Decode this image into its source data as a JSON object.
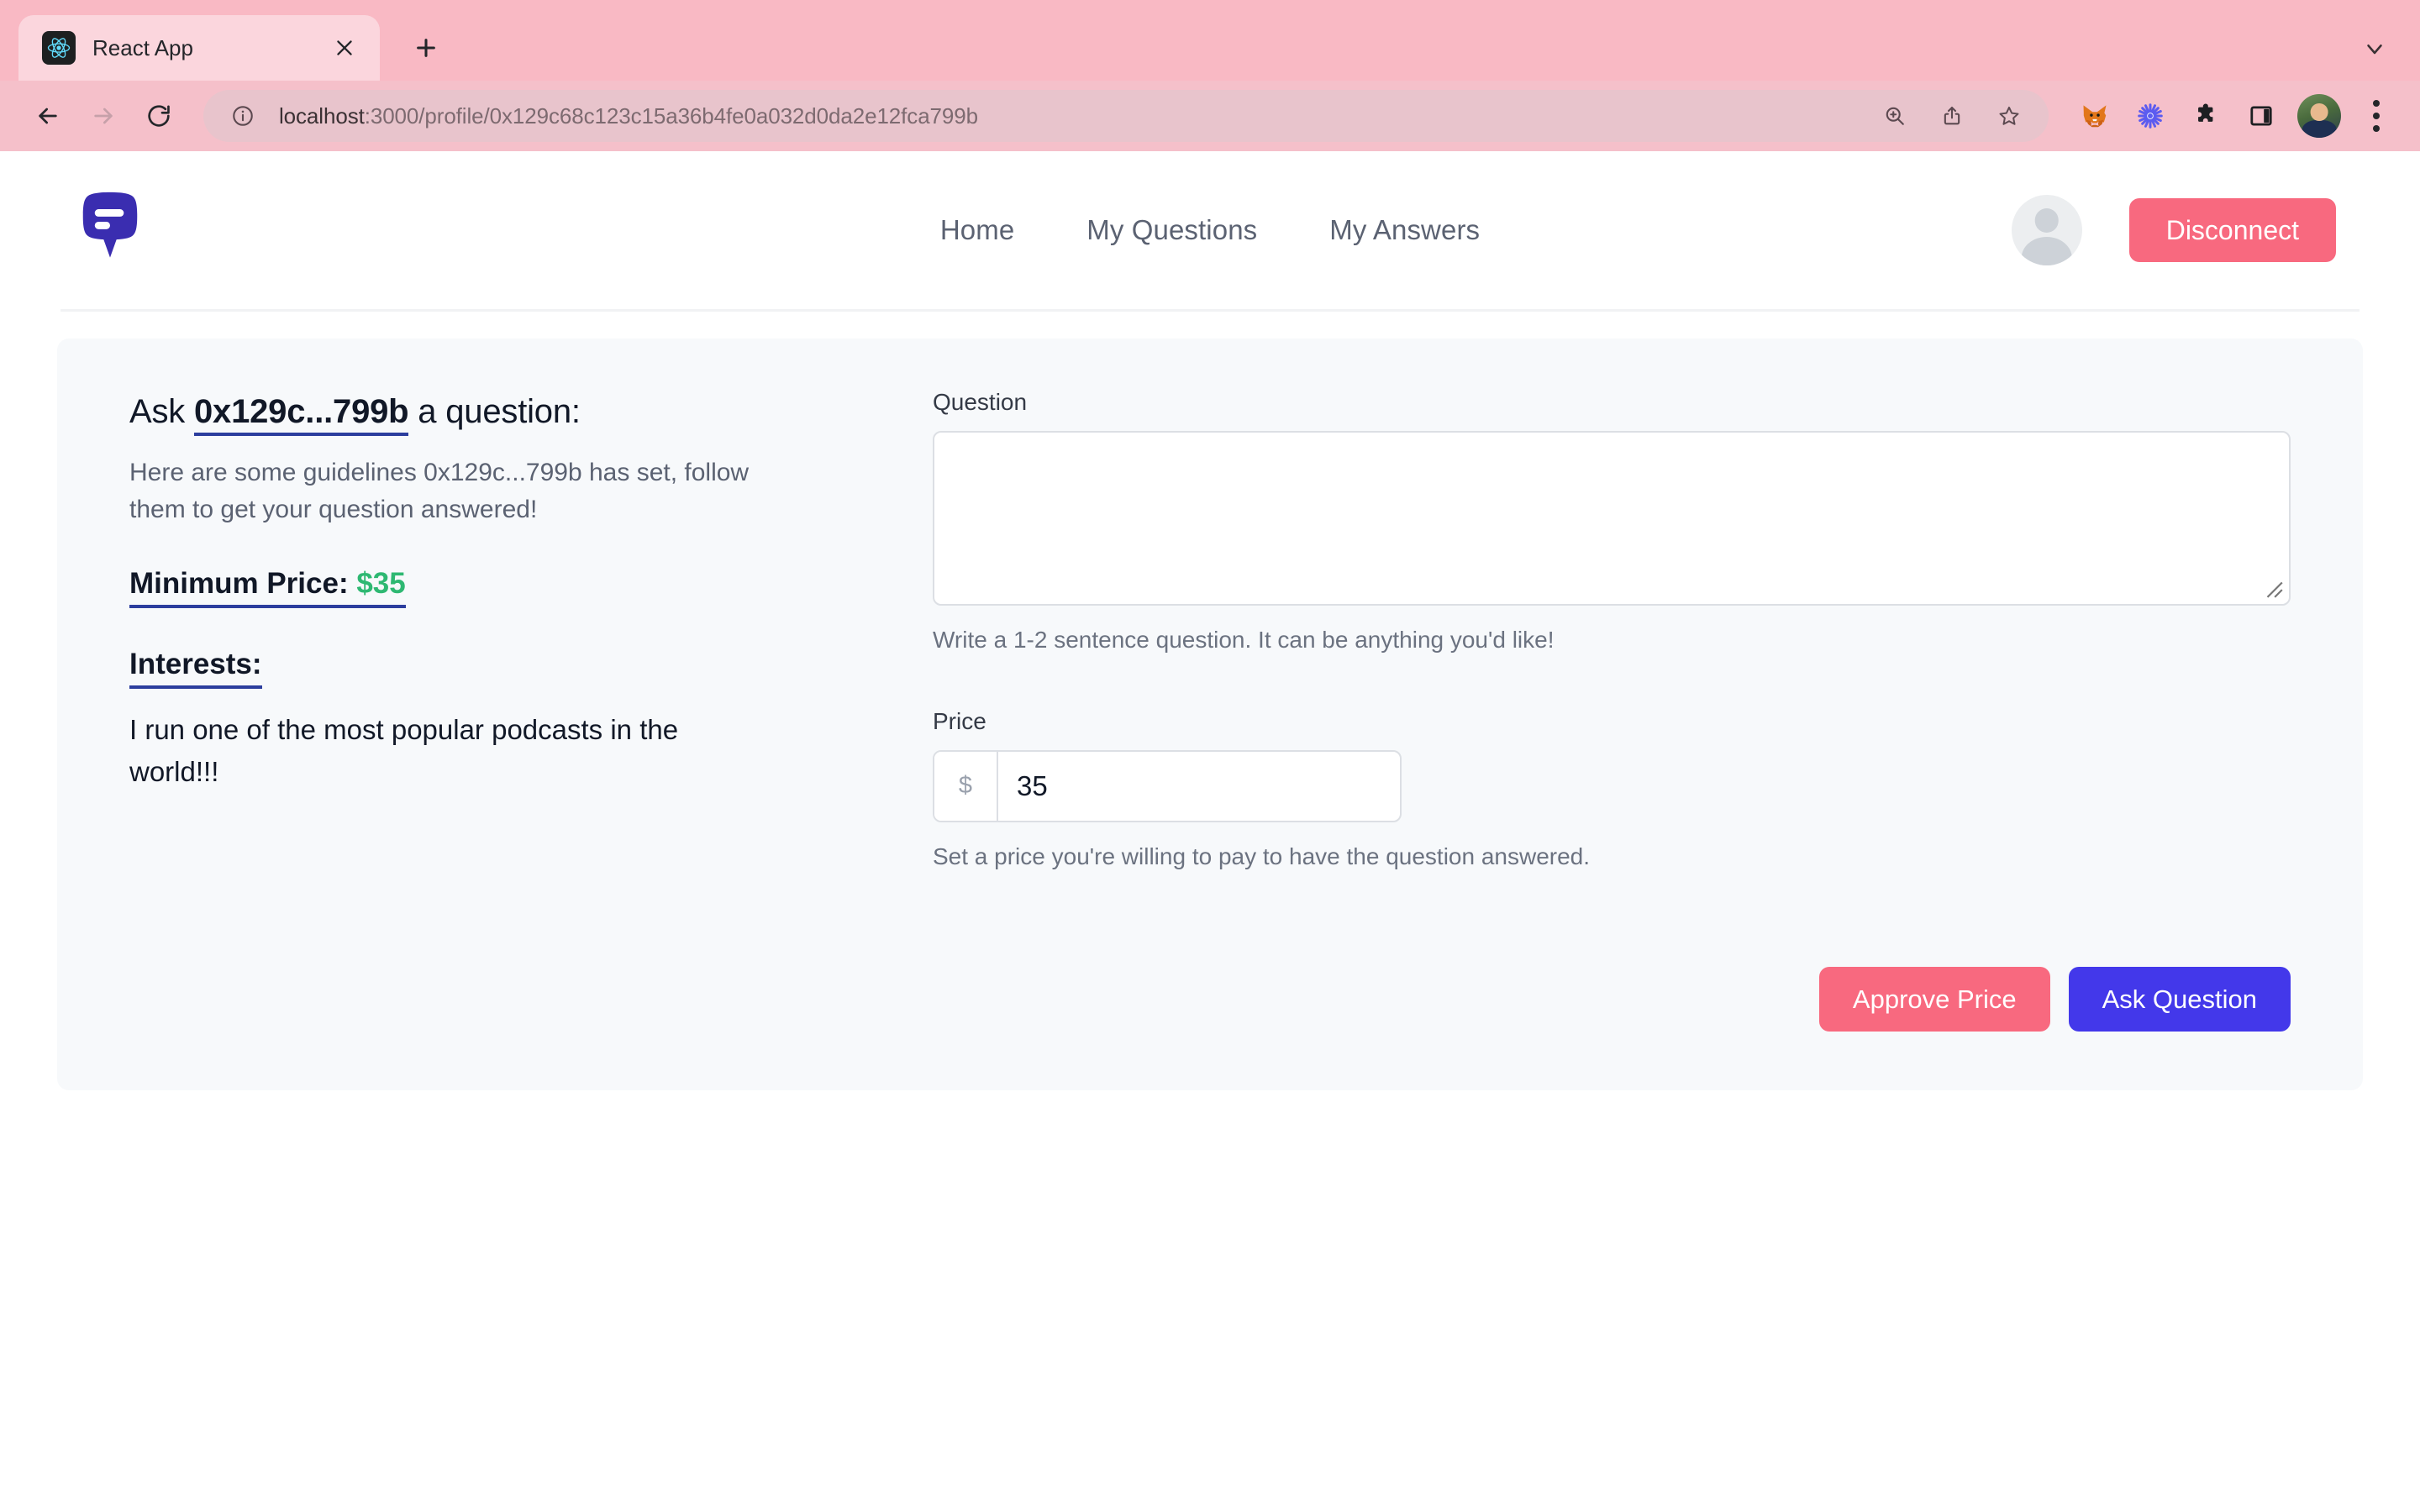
{
  "browser": {
    "tab": {
      "title": "React App",
      "favicon_icon": "react-logo-icon",
      "close_icon": "close-icon"
    },
    "new_tab_icon": "plus-icon",
    "tab_list_chevron_icon": "chevron-down-icon",
    "back_icon": "back-arrow-icon",
    "forward_icon": "forward-arrow-icon",
    "reload_icon": "reload-icon",
    "site_info_icon": "info-circle-icon",
    "url_prefix": "localhost",
    "url_suffix": ":3000/profile/0x129c68c123c15a36b4fe0a032d0da2e12fca799b",
    "url_full": "localhost:3000/profile/0x129c68c123c15a36b4fe0a032d0da2e12fca799b",
    "omnibox_actions": [
      "zoom-in-icon",
      "share-icon",
      "bookmark-star-icon"
    ],
    "extensions": [
      "metamask-fox-icon",
      "blue-asterisk-extension-icon",
      "puzzle-piece-icon",
      "side-panel-icon"
    ],
    "profile_avatar_icon": "browser-profile-avatar",
    "menu_icon": "three-dot-menu-icon"
  },
  "header": {
    "logo_icon": "chat-bubble-logo-icon",
    "nav": [
      {
        "label": "Home"
      },
      {
        "label": "My Questions"
      },
      {
        "label": "My Answers"
      }
    ],
    "avatar_icon": "user-avatar-icon",
    "disconnect_label": "Disconnect"
  },
  "profile": {
    "ask_prefix": "Ask ",
    "address_short": "0x129c...799b",
    "ask_suffix": " a question:",
    "guidelines": "Here are some guidelines 0x129c...799b has set, follow them to get your question answered!",
    "minimum_price_label": "Minimum Price:",
    "minimum_price_value": "$35",
    "interests_label": "Interests:",
    "interests_body": "I run one of the most popular podcasts in the world!!!"
  },
  "form": {
    "question_label": "Question",
    "question_value": "",
    "question_placeholder": "",
    "question_help": "Write a 1-2 sentence question. It can be anything you'd like!",
    "price_label": "Price",
    "price_currency_symbol": "$",
    "price_value": "35",
    "price_help": "Set a price you're willing to pay to have the question answered.",
    "approve_label": "Approve Price",
    "ask_label": "Ask Question"
  },
  "colors": {
    "brand_purple": "#4338ea",
    "accent_pink": "#f8697f",
    "success_green": "#2eb872",
    "underline_blue": "#2c3e9e",
    "card_bg": "#f7f9fb"
  }
}
